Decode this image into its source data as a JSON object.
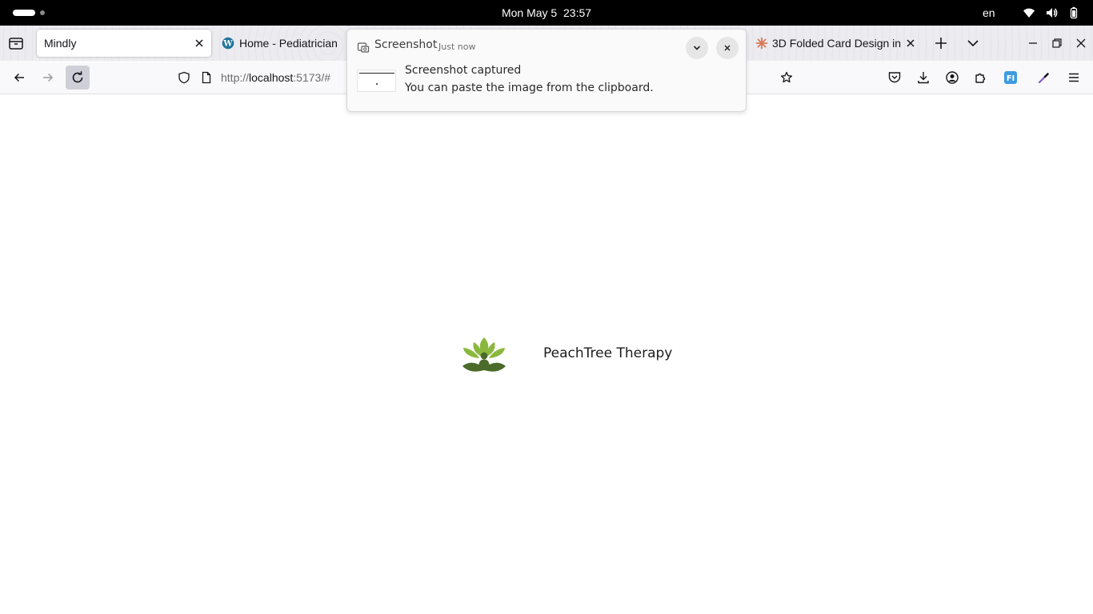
{
  "system_bar": {
    "clock": "Mon May 5  23:57",
    "language": "en"
  },
  "browser": {
    "tabs": [
      {
        "title": "Mindly",
        "active": true
      },
      {
        "title": "Home - Pediatrician",
        "active": false
      },
      {
        "title": "3D Folded Card Design in",
        "active": false
      }
    ],
    "url": {
      "scheme": "http://",
      "host": "localhost",
      "rest": ":5173/#"
    }
  },
  "notification": {
    "app": "Screenshot",
    "time": "Just now",
    "title": "Screenshot captured",
    "body": "You can paste the image from the clipboard."
  },
  "page": {
    "brand_name": "PeachTree Therapy"
  },
  "colors": {
    "logo_light_green": "#8ab83e",
    "logo_dark_green": "#4b6b2a",
    "anthropic_orange": "#d97757",
    "wordpress_blue": "#21759b"
  }
}
